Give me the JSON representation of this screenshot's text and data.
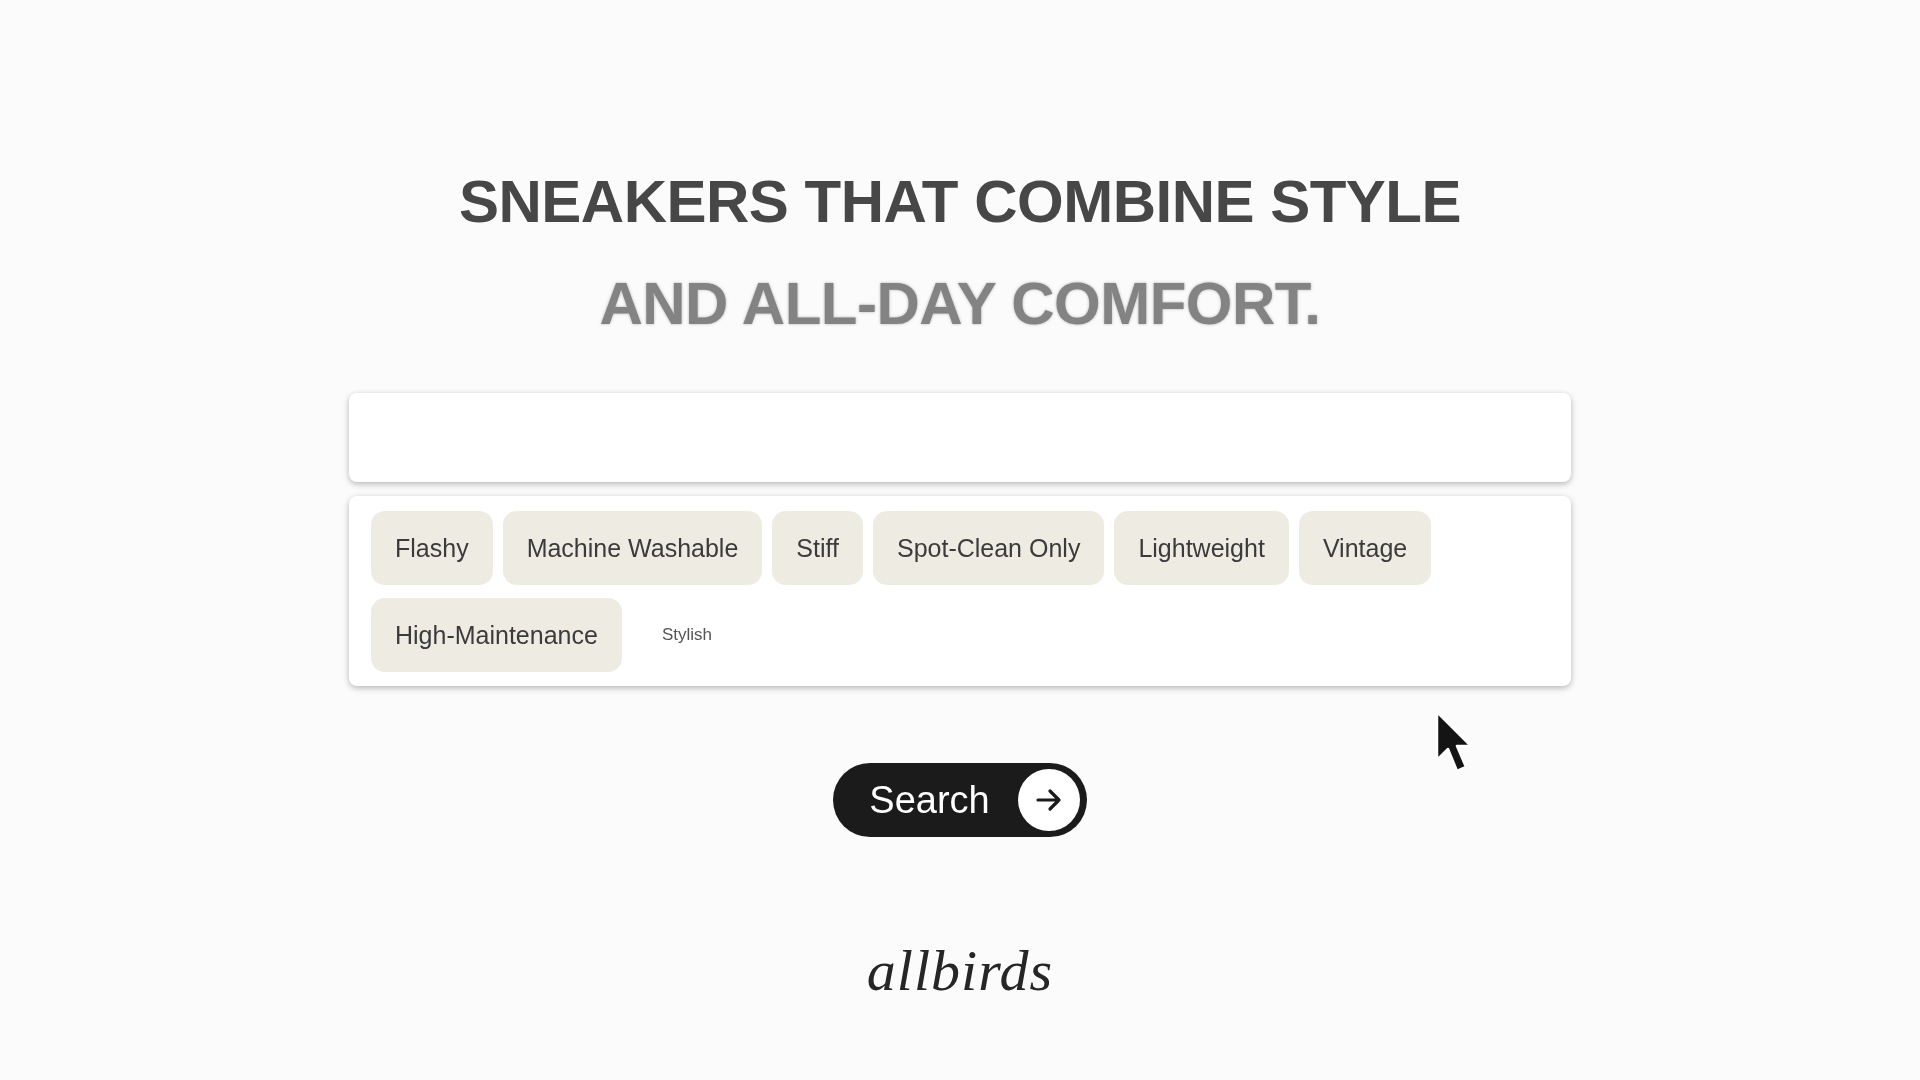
{
  "headline": [
    {
      "text": "SNEAKERS THAT COMBINE STYLE",
      "kind": "solid"
    },
    {
      "text": "AND ALL-DAY COMFORT.",
      "kind": "faded"
    }
  ],
  "tags": [
    {
      "label": "Flashy",
      "kind": "chip"
    },
    {
      "label": "Machine Washable",
      "kind": "chip"
    },
    {
      "label": "Stiff",
      "kind": "chip"
    },
    {
      "label": "Spot-Clean Only",
      "kind": "chip"
    },
    {
      "label": "Lightweight",
      "kind": "chip"
    },
    {
      "label": "Vintage",
      "kind": "chip"
    },
    {
      "label": "High-Maintenance",
      "kind": "chip"
    },
    {
      "label": "Stylish",
      "kind": "plain"
    }
  ],
  "search_button": {
    "label": "Search"
  },
  "logo": {
    "text": "allbirds"
  }
}
